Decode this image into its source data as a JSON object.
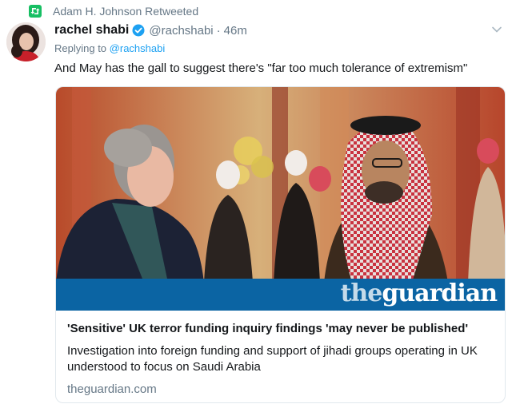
{
  "retweet": {
    "label": "Adam H. Johnson Retweeted",
    "icon": "retweet-icon",
    "icon_color": "#17bf63"
  },
  "author": {
    "display_name": "rachel shabi",
    "handle": "@rachshabi",
    "separator": "·",
    "time": "46m",
    "verified": true,
    "verified_color": "#1da1f2"
  },
  "reply": {
    "prefix": "Replying to",
    "to_handle": "@rachshabi"
  },
  "tweet": {
    "text": "And May has the gall to suggest there's \"far too much tolerance of extremism\""
  },
  "card": {
    "image_brand": "theguardian",
    "title": "'Sensitive' UK terror funding inquiry findings 'may never be published'",
    "description": "Investigation into foreign funding and support of jihadi groups operating in UK understood to focus on Saudi Arabia",
    "domain": "theguardian.com",
    "brand_color": "#0b64a3"
  },
  "colors": {
    "link": "#1da1f2",
    "muted": "#657786",
    "text": "#14171a"
  }
}
